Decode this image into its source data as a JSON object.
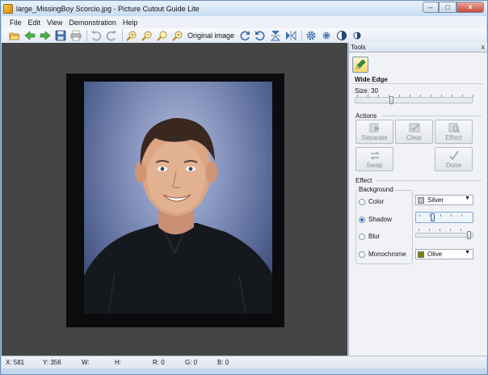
{
  "window": {
    "title": "large_MissingBoy Scorcio.jpg - Picture Cutout Guide Lite",
    "controls": {
      "minimize": "–",
      "maximize": "□",
      "close": "✕"
    }
  },
  "menu": [
    "File",
    "Edit",
    "View",
    "Demonstration",
    "Help"
  ],
  "toolbar": {
    "original_image_label": "Original image",
    "icons": [
      "open-folder-icon",
      "back-arrow-icon",
      "forward-arrow-icon",
      "save-icon",
      "print-icon",
      "undo-icon",
      "redo-icon",
      "zoom-in-icon",
      "zoom-out-icon",
      "zoom-fit-icon",
      "zoom-actual-icon",
      "rotate-cw-icon",
      "rotate-ccw-icon",
      "flip-vertical-icon",
      "flip-horizontal-icon",
      "settings-gear-icon",
      "settings-small-gear-icon",
      "contrast-icon",
      "contrast-small-icon"
    ]
  },
  "tools": {
    "header": "Tools",
    "close": "x",
    "section_title": "Wide Edge",
    "size_label": "Size: 30",
    "size_value": 30,
    "actions_label": "Actions",
    "actions": [
      "Separate",
      "Clear",
      "Effect",
      "Swap",
      "Done"
    ],
    "effect_label": "Effect",
    "background_label": "Background",
    "options": [
      "Color",
      "Shadow",
      "Blur",
      "Monochrome"
    ],
    "selected_option": "Shadow",
    "color_combo": {
      "value": "Silver",
      "swatch": "#c0c0c0"
    },
    "mono_combo": {
      "value": "Olive",
      "swatch": "#808000"
    }
  },
  "status": {
    "x": "X: 581",
    "y": "Y: 356",
    "w": "W:",
    "h": "H:",
    "r": "R: 0",
    "g": "G: 0",
    "b": "B: 0"
  },
  "colors": {
    "canvas_bg": "#454545",
    "accent": "#2e6fc2"
  }
}
